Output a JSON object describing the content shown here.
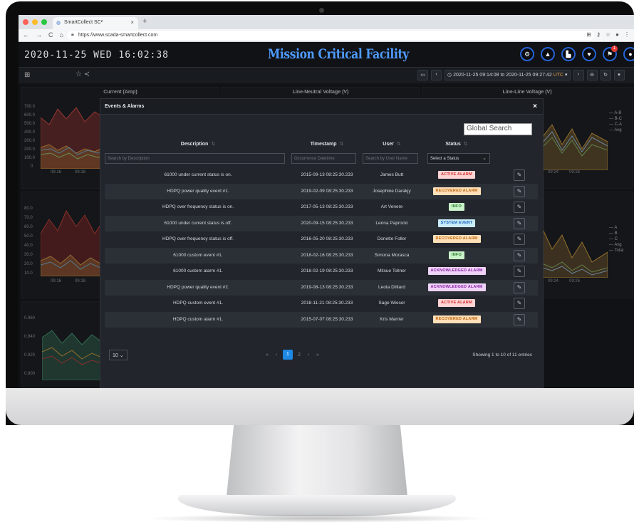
{
  "browser": {
    "tab_title": "SmartCollect SC²",
    "tab_icon": "globe-icon",
    "url": "https://www.scada-smartcollect.com",
    "colors": {
      "close": "#ff5f57",
      "minimize": "#febc2e",
      "maximize": "#28c840"
    }
  },
  "header": {
    "clock": "2020-11-25 WED 16:02:38",
    "title": "Mission Critical Facility",
    "icons": [
      "settings-icon",
      "up-icon",
      "factory-icon",
      "heart-icon",
      "alarm-icon",
      "user-icon"
    ],
    "alarm_badge": "1",
    "accent": "#4f9bff"
  },
  "toolbar": {
    "time_range": "2020-11-25 09:14:08 to 2020-11-25 09:27:42",
    "tz": "UTC"
  },
  "panels": {
    "current_title": "Current (Amp)",
    "ln_voltage_title": "Line-Neutral Voltage (V)",
    "ll_voltage_title": "Line-Line Voltage (V)",
    "current_yticks": [
      "700.0",
      "600.0",
      "500.0",
      "400.0",
      "300.0",
      "200.0",
      "100.0",
      "0"
    ],
    "current_xticks": [
      "09:16",
      "09:18"
    ],
    "ll_legend": [
      "— A-B",
      "— B-C",
      "— C-A",
      "— Avg"
    ],
    "ll_xticks": [
      "09:24",
      "09:26"
    ],
    "row2_yticks": [
      "80.0",
      "70.0",
      "60.0",
      "50.0",
      "40.0",
      "30.0",
      "20.0",
      "10.0"
    ],
    "row2_xticks": [
      "09:16",
      "09:18"
    ],
    "row2_legend": [
      "— A",
      "— B",
      "— C",
      "— Avg",
      "— Total"
    ],
    "row2_right_xticks": [
      "09:24",
      "09:26"
    ],
    "row3_yticks": [
      "0.960",
      "0.940",
      "0.920",
      "0.900"
    ]
  },
  "modal": {
    "title": "Events & Alarms",
    "close": "×",
    "global_search_placeholder": "Global Search",
    "columns": [
      "Description",
      "Timestamp",
      "User",
      "Status"
    ],
    "filters": {
      "description": "Search by Description",
      "timestamp": "Occurrence Datetime",
      "user": "Search by User Name",
      "status": "Select a Status"
    },
    "rows": [
      {
        "description": "61000 under current status is on.",
        "timestamp": "2015-09-13 08:25:30.233",
        "user": "James Butt",
        "status": "ACTIVE ALARM"
      },
      {
        "description": "HDPQ power quality event #1.",
        "timestamp": "2019-02-09 08:25:30.233",
        "user": "Josephine Darakjy",
        "status": "RECOVERED ALARM"
      },
      {
        "description": "HDPQ over frequency status is on.",
        "timestamp": "2017-05-13 08:25:30.233",
        "user": "Art Venere",
        "status": "INFO"
      },
      {
        "description": "61000 under current status is off.",
        "timestamp": "2020-09-15 08:25:30.233",
        "user": "Lenna Paprocki",
        "status": "SYSTEM EVENT"
      },
      {
        "description": "HDPQ over frequency status is off.",
        "timestamp": "2016-05-20 08:25:30.233",
        "user": "Donette Foller",
        "status": "RECOVERED ALARM"
      },
      {
        "description": "61000 custom event #1.",
        "timestamp": "2018-02-16 08:25:30.233",
        "user": "Simona Morasca",
        "status": "INFO"
      },
      {
        "description": "61000 custom alarm #1.",
        "timestamp": "2018-02-19 08:25:30.233",
        "user": "Mitsue Tollner",
        "status": "ACKNOWLEDGED ALARM"
      },
      {
        "description": "HDPQ power quality event #2.",
        "timestamp": "2019-08-13 08:25:30.233",
        "user": "Leota Dilliard",
        "status": "ACKNOWLEDGED ALARM"
      },
      {
        "description": "HDPQ custom event #1.",
        "timestamp": "2018-11-21 08:25:30.233",
        "user": "Sage Wieser",
        "status": "ACTIVE ALARM"
      },
      {
        "description": "HDPQ custom alarm #1.",
        "timestamp": "2015-07-07 08:25:30.233",
        "user": "Kris Marrier",
        "status": "RECOVERED ALARM"
      }
    ],
    "status_colors": {
      "ACTIVE ALARM": {
        "bg": "#ffd4d4",
        "fg": "#d32f2f"
      },
      "RECOVERED ALARM": {
        "bg": "#ffe0b8",
        "fg": "#c26a12"
      },
      "INFO": {
        "bg": "#c9f2c9",
        "fg": "#2e7d32"
      },
      "SYSTEM EVENT": {
        "bg": "#c9ecf7",
        "fg": "#1565c0"
      },
      "ACKNOWLEDGED ALARM": {
        "bg": "#efd3f7",
        "fg": "#8e24aa"
      }
    },
    "page_size": "10",
    "pager": {
      "current": "1",
      "next": "2"
    },
    "showing": "Showing 1 to 10 of 11 entries"
  }
}
